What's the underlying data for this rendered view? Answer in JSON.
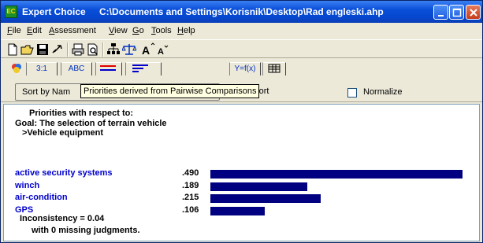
{
  "window": {
    "app_name": "Expert Choice",
    "file_path": "C:\\Documents and Settings\\Korisnik\\Desktop\\Rad engleski.ahp",
    "icon_text": "EC"
  },
  "menu": {
    "items": [
      {
        "label": "File",
        "u": "F",
        "rest": "ile"
      },
      {
        "label": "Edit",
        "u": "E",
        "rest": "dit"
      },
      {
        "label": "Assessment",
        "u": "A",
        "rest": "ssessment"
      },
      {
        "label": "View",
        "u": "V",
        "rest": "iew"
      },
      {
        "label": "Go",
        "u": "G",
        "rest": "o"
      },
      {
        "label": "Tools",
        "u": "T",
        "rest": "ools"
      },
      {
        "label": "Help",
        "u": "H",
        "rest": "elp"
      }
    ]
  },
  "tabs": {
    "ratio": "3:1",
    "abc": "ABC",
    "formula": "Y=f(x)"
  },
  "options": {
    "sort_label": "Sort by Nam",
    "tooltip": "Priorities derived from Pairwise Comparisons",
    "unsort_label": "Unsort",
    "unsort_u": "U",
    "unsort_rest": "nsort",
    "normalize_label": "Normalize"
  },
  "content": {
    "heading": "Priorities with respect to:",
    "goal": "Goal: The selection of terrain vehicle",
    "node": ">Vehicle equipment",
    "inconsistency": "Inconsistency = 0.04",
    "missing": "with 0  missing judgments."
  },
  "chart_data": {
    "type": "bar",
    "categories": [
      "active security systems",
      "winch",
      "air-condition",
      "GPS"
    ],
    "values": [
      0.49,
      0.189,
      0.215,
      0.106
    ],
    "value_labels": [
      ".490",
      ".189",
      ".215",
      ".106"
    ],
    "bar_color": "#000080",
    "label_color": "#0000cc"
  },
  "colors": {
    "titlebar": "#0a4fd8",
    "window_bg": "#ece9d8",
    "bar": "#000080"
  }
}
